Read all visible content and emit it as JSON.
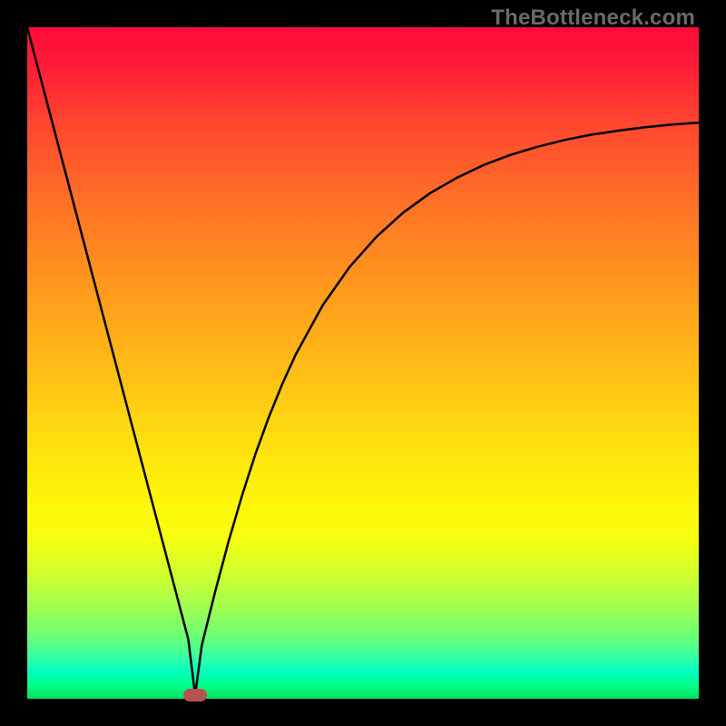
{
  "watermark": "TheBottleneck.com",
  "chart_data": {
    "type": "line",
    "title": "",
    "xlabel": "",
    "ylabel": "",
    "xlim": [
      0,
      100
    ],
    "ylim": [
      0,
      100
    ],
    "grid": false,
    "legend": false,
    "series": [
      {
        "name": "curve",
        "x": [
          0,
          2,
          4,
          6,
          8,
          10,
          12,
          14,
          16,
          18,
          20,
          22,
          24,
          25,
          26,
          28,
          30,
          32,
          34,
          36,
          38,
          40,
          44,
          48,
          52,
          56,
          60,
          64,
          68,
          72,
          76,
          80,
          84,
          88,
          92,
          96,
          100
        ],
        "y": [
          100,
          92.4,
          84.8,
          77.2,
          69.6,
          62.0,
          54.4,
          46.8,
          39.2,
          31.6,
          24.0,
          16.4,
          8.8,
          0.5,
          8.0,
          16.0,
          23.5,
          30.3,
          36.5,
          42.0,
          46.9,
          51.3,
          58.6,
          64.3,
          68.8,
          72.4,
          75.3,
          77.6,
          79.5,
          81.0,
          82.2,
          83.2,
          84.0,
          84.6,
          85.1,
          85.5,
          85.8
        ]
      }
    ],
    "marker": {
      "x": 25,
      "y": 0.5
    },
    "background_gradient": {
      "top": "#ff0b3a",
      "bottom": "#00e060"
    }
  }
}
